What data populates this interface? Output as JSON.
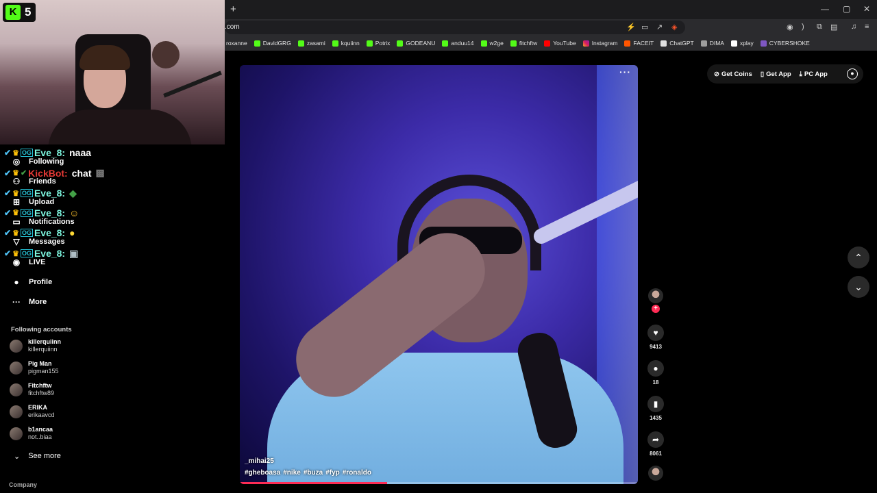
{
  "browser": {
    "new_tab_label": "+",
    "url": ".com",
    "window_controls": [
      "—",
      "▢",
      "✕"
    ],
    "bookmarks": [
      {
        "label": "roxanne",
        "icon": "none"
      },
      {
        "label": "DavidGRG",
        "icon": "kick"
      },
      {
        "label": "zasami",
        "icon": "kick"
      },
      {
        "label": "kquiinn",
        "icon": "kick"
      },
      {
        "label": "Potrix",
        "icon": "kick"
      },
      {
        "label": "GODEANU",
        "icon": "kick"
      },
      {
        "label": "anduu14",
        "icon": "kick"
      },
      {
        "label": "w2ge",
        "icon": "kick"
      },
      {
        "label": "fitchftw",
        "icon": "kick"
      },
      {
        "label": "YouTube",
        "icon": "youtube"
      },
      {
        "label": "Instagram",
        "icon": "instagram"
      },
      {
        "label": "FACEIT",
        "icon": "faceit"
      },
      {
        "label": "ChatGPT",
        "icon": "chatgpt"
      },
      {
        "label": "DIMA",
        "icon": "dima"
      },
      {
        "label": "xplay",
        "icon": "xplay"
      },
      {
        "label": "CYBERSHOKE",
        "icon": "cybershoke"
      }
    ]
  },
  "webcam": {
    "viewer_count": "5"
  },
  "nav": {
    "following": "Following",
    "friends": "Friends",
    "upload": "Upload",
    "notifications": "Notifications",
    "messages": "Messages",
    "live": "LIVE",
    "profile": "Profile",
    "more": "More"
  },
  "chat": [
    {
      "user": "Eve_8:",
      "message": "naaa",
      "type": "user"
    },
    {
      "user": "KickBot:",
      "message": "chat",
      "type": "bot"
    },
    {
      "user": "Eve_8:",
      "message": "",
      "type": "user"
    },
    {
      "user": "Eve_8:",
      "message": "",
      "type": "user"
    },
    {
      "user": "Eve_8:",
      "message": "",
      "type": "user"
    },
    {
      "user": "Eve_8:",
      "message": "",
      "type": "user"
    }
  ],
  "following": {
    "title": "Following accounts",
    "accounts": [
      {
        "name": "killerquiinn",
        "handle": "killerquiinn"
      },
      {
        "name": "Pig Man",
        "handle": "pigman155"
      },
      {
        "name": "Fitchftw",
        "handle": "fitchftw89"
      },
      {
        "name": "ERIKA",
        "handle": "erikaavcd"
      },
      {
        "name": "b1ancaa",
        "handle": "not..biaa"
      }
    ],
    "see_more": "See more"
  },
  "footer": {
    "company": "Company"
  },
  "topbar": {
    "get_coins": "Get Coins",
    "get_app": "Get App",
    "pc_app": "PC App"
  },
  "video": {
    "author": "_mihai25",
    "hashtags": [
      "#gheboasa",
      "#nike",
      "#buza",
      "#fyp",
      "#ronaldo"
    ],
    "progress": 0.37,
    "more_label": "···"
  },
  "actions": {
    "likes": "9413",
    "comments": "18",
    "saves": "1435",
    "shares": "8061"
  },
  "colors": {
    "accent": "#fe2c55",
    "kick_green": "#53fc18"
  }
}
